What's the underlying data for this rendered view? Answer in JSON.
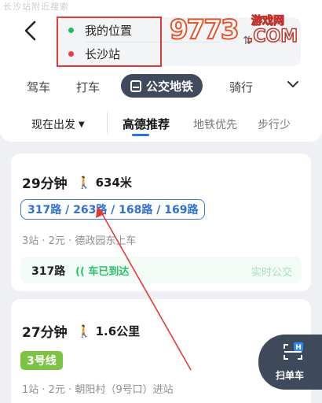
{
  "top_faint_text": "长沙站附近搜索",
  "route": {
    "origin": "我的位置",
    "destination": "长沙站"
  },
  "watermark": {
    "number": "9773",
    "site_name": "游戏网",
    "domain": ".COM"
  },
  "modes": {
    "items": [
      "驾车",
      "打车",
      "公交地铁",
      "骑行"
    ],
    "active": "公交地铁"
  },
  "filters": {
    "time": "现在出发",
    "options": [
      "高德推荐",
      "地铁优先",
      "步行少"
    ],
    "active": "高德推荐"
  },
  "routes": [
    {
      "duration": "29分钟",
      "walk": "634米",
      "lines": "317路 / 263路 / 168路 / 169路",
      "meta": "3站 · 2元 · 德政园东上车",
      "live": {
        "line": "317路",
        "status": "车已到达",
        "tag": "实时公交"
      }
    },
    {
      "duration": "27分钟",
      "walk": "1.6公里",
      "badge": "3号线",
      "meta": "1站 · 2元 · 朝阳村（9号口）进站"
    }
  ],
  "scan_button": {
    "label": "扫单车"
  },
  "colors": {
    "accent_blue": "#2f6fd6",
    "active_mode_bg": "#3f4a5c",
    "line3_green": "#7dc242",
    "live_green": "#2cc06b",
    "annotation_red": "#e53935"
  }
}
